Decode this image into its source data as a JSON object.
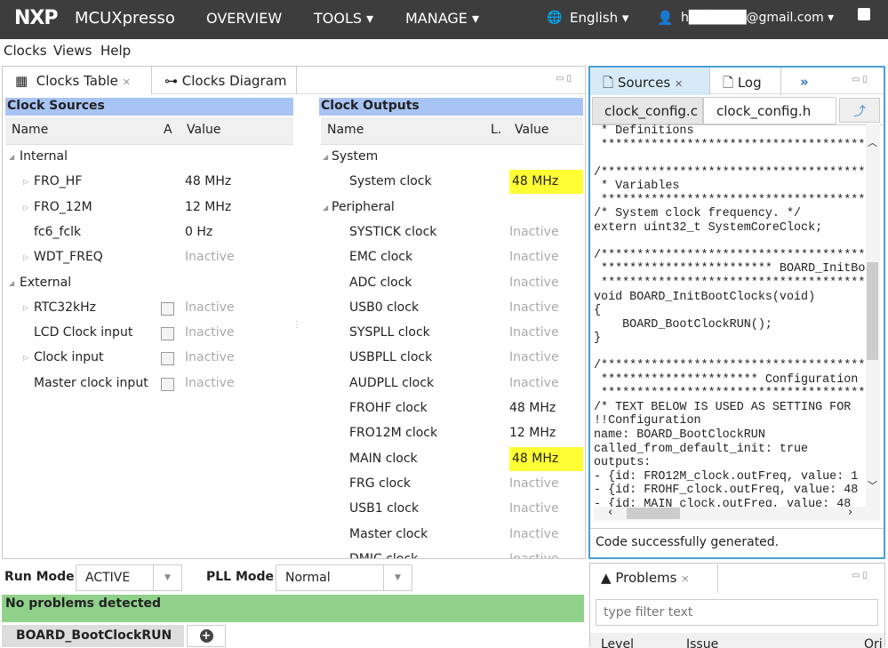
{
  "topbar": {
    "logo": "NXP",
    "app": "MCUXpresso",
    "nav": [
      "OVERVIEW",
      "TOOLS ▾",
      "MANAGE ▾"
    ],
    "language": "English ▾",
    "user": "h██████@gmail.com ▾"
  },
  "menu": [
    "Clocks",
    "Views",
    "Help"
  ],
  "left_panel": {
    "tabs": [
      "Clocks Table",
      "Clocks Diagram"
    ],
    "sources": {
      "title": "Clock Sources",
      "cols": [
        "Name",
        "A",
        "Value"
      ],
      "rows": [
        {
          "name": "Internal",
          "value": "",
          "group": true
        },
        {
          "name": "FRO_HF",
          "value": "48 MHz",
          "expand": true
        },
        {
          "name": "FRO_12M",
          "value": "12 MHz",
          "expand": true
        },
        {
          "name": "fc6_fclk",
          "value": "0 Hz"
        },
        {
          "name": "WDT_FREQ",
          "value": "Inactive",
          "expand": true,
          "inactive": true
        },
        {
          "name": "External",
          "value": "",
          "group": true
        },
        {
          "name": "RTC32kHz",
          "value": "Inactive",
          "expand": true,
          "inactive": true,
          "checkbox": true
        },
        {
          "name": "LCD Clock input",
          "value": "Inactive",
          "inactive": true,
          "checkbox": true
        },
        {
          "name": "Clock input",
          "value": "Inactive",
          "expand": true,
          "inactive": true,
          "checkbox": true
        },
        {
          "name": "Master clock input",
          "value": "Inactive",
          "inactive": true,
          "checkbox": true
        }
      ]
    },
    "outputs": {
      "title": "Clock Outputs",
      "cols": [
        "Name",
        "L.",
        "Value"
      ],
      "rows": [
        {
          "name": "System",
          "value": "",
          "group": true
        },
        {
          "name": "System clock",
          "value": "48 MHz",
          "highlight": true
        },
        {
          "name": "Peripheral",
          "value": "",
          "group": true
        },
        {
          "name": "SYSTICK clock",
          "value": "Inactive",
          "inactive": true
        },
        {
          "name": "EMC clock",
          "value": "Inactive",
          "inactive": true
        },
        {
          "name": "ADC clock",
          "value": "Inactive",
          "inactive": true
        },
        {
          "name": "USB0 clock",
          "value": "Inactive",
          "inactive": true
        },
        {
          "name": "SYSPLL clock",
          "value": "Inactive",
          "inactive": true
        },
        {
          "name": "USBPLL clock",
          "value": "Inactive",
          "inactive": true
        },
        {
          "name": "AUDPLL clock",
          "value": "Inactive",
          "inactive": true
        },
        {
          "name": "FROHF clock",
          "value": "48 MHz"
        },
        {
          "name": "FRO12M clock",
          "value": "12 MHz"
        },
        {
          "name": "MAIN clock",
          "value": "48 MHz",
          "highlight": true
        },
        {
          "name": "FRG clock",
          "value": "Inactive",
          "inactive": true
        },
        {
          "name": "USB1 clock",
          "value": "Inactive",
          "inactive": true
        },
        {
          "name": "Master clock",
          "value": "Inactive",
          "inactive": true
        },
        {
          "name": "DMIC clock",
          "value": "Inactive",
          "inactive": true
        }
      ]
    }
  },
  "right_panel": {
    "tabs": [
      "Sources",
      "Log",
      "»"
    ],
    "files": [
      "clock_config.c",
      "clock_config.h"
    ],
    "code": [
      " * Definitions",
      " ****************************************",
      "",
      "/****************************************",
      " * Variables",
      " ****************************************",
      "/* System clock frequency. */",
      "extern uint32_t SystemCoreClock;",
      "",
      "/****************************************",
      " ************************ BOARD_InitBootClocks",
      " ****************************************",
      "void BOARD_InitBootClocks(void)",
      "{",
      "    BOARD_BootClockRUN();",
      "}",
      "",
      "/****************************************",
      " ********************** Configuration",
      " ****************************************",
      "/* TEXT BELOW IS USED AS SETTING FOR",
      "!!Configuration",
      "name: BOARD_BootClockRUN",
      "called_from_default_init: true",
      "outputs:",
      "- {id: FRO12M_clock.outFreq, value: 1",
      "- {id: FROHF_clock.outFreq, value: 48",
      "- {id: MAIN_clock.outFreq, value: 48"
    ],
    "status": "Code successfully generated."
  },
  "bottom": {
    "run_mode_label": "Run Mode",
    "run_mode": "ACTIVE",
    "pll_mode_label": "PLL Mode",
    "pll_mode": "Normal",
    "problems_status": "No problems detected",
    "config_tab": "BOARD_BootClockRUN"
  },
  "problems": {
    "tab": "Problems",
    "filter_placeholder": "type filter text",
    "cols": [
      "Level",
      "Issue",
      "Ori"
    ]
  },
  "colors": {
    "topbar": "#3d3d3d",
    "section_header": "#a8c4f5",
    "highlight": "#ffff33",
    "ok": "#8fd18a",
    "active_tab": "#d6ebf7"
  }
}
